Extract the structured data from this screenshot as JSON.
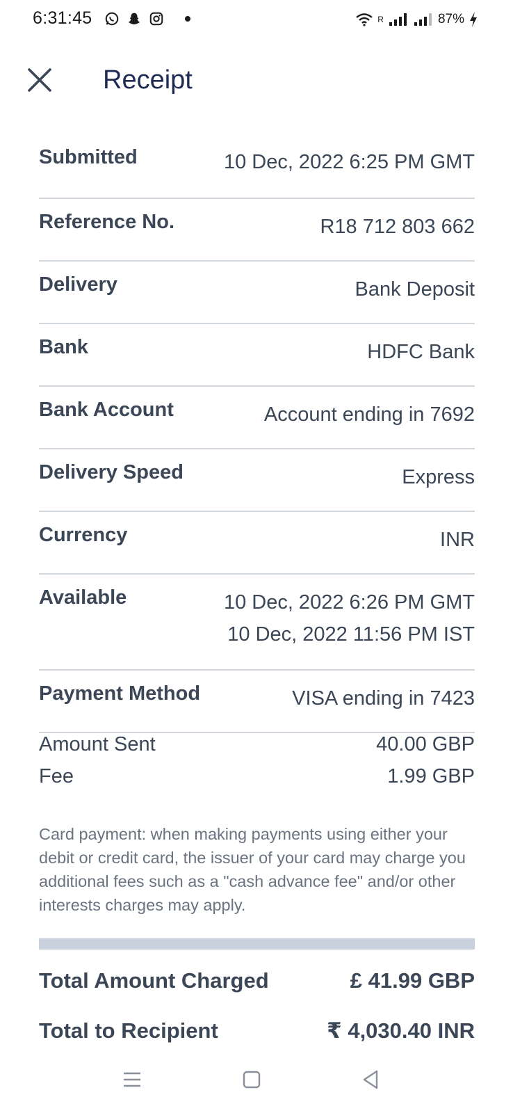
{
  "status_bar": {
    "time": "6:31:45",
    "left_icons": [
      "whatsapp-icon",
      "snapchat-icon",
      "instagram-icon",
      "notification-dot-icon"
    ],
    "signal_label": "R",
    "battery": "87%"
  },
  "header": {
    "title": "Receipt",
    "close_icon": "close-icon"
  },
  "rows": [
    {
      "label": "Submitted",
      "value": "10 Dec, 2022 6:25 PM GMT"
    },
    {
      "label": "Reference No.",
      "value": "R18 712 803 662"
    },
    {
      "label": "Delivery",
      "value": "Bank Deposit"
    },
    {
      "label": "Bank",
      "value": "HDFC Bank"
    },
    {
      "label": "Bank Account",
      "value": "Account ending in 7692"
    },
    {
      "label": "Delivery Speed",
      "value": "Express"
    },
    {
      "label": "Currency",
      "value": "INR"
    },
    {
      "label": "Available",
      "value": "10 Dec, 2022 6:26 PM GMT",
      "value2": "10 Dec, 2022 11:56 PM IST"
    },
    {
      "label": "Payment Method",
      "value": "VISA ending in 7423"
    }
  ],
  "amounts": [
    {
      "label": "Amount Sent",
      "value": "40.00 GBP"
    },
    {
      "label": "Fee",
      "value": "1.99 GBP"
    }
  ],
  "disclaimer": "Card payment: when making payments using either your debit or credit card, the issuer of your card may charge you additional fees such as a \"cash advance fee\" and/or other interests charges may apply.",
  "totals": [
    {
      "label": "Total Amount Charged",
      "value": "£ 41.99 GBP"
    },
    {
      "label": "Total to Recipient",
      "value": "₹ 4,030.40 INR"
    }
  ],
  "nav_bar": [
    "menu-icon",
    "home-icon",
    "back-icon"
  ],
  "colors": {
    "title": "#1f2a55",
    "text": "#3b4757",
    "divider": "#d3d8de",
    "bar": "#c8d1dc"
  }
}
